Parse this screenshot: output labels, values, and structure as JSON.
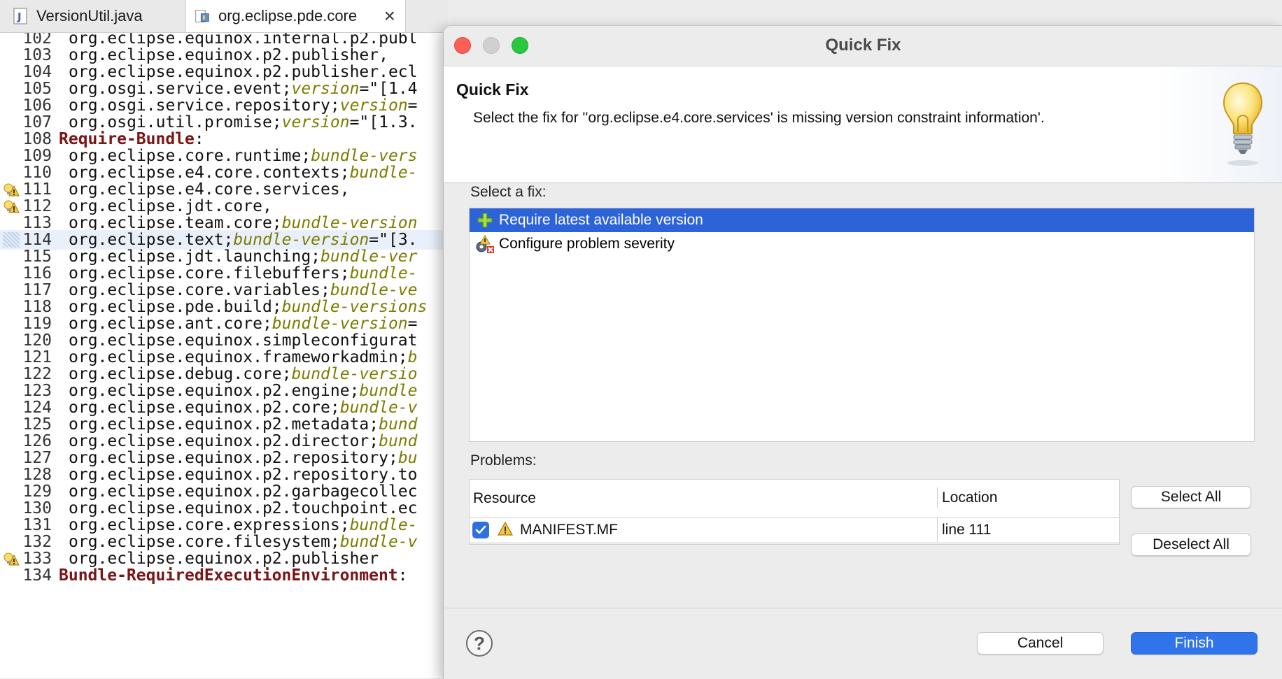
{
  "editor": {
    "tabs": [
      {
        "label": "VersionUtil.java",
        "icon": "java-file-icon"
      },
      {
        "label": "org.eclipse.pde.core",
        "icon": "plugin-manifest-icon",
        "active": true
      }
    ],
    "lines": [
      {
        "num": "102",
        "parts": [
          {
            "t": "org.eclipse.equinox.internal.p2.publ",
            "c": "plain"
          }
        ]
      },
      {
        "num": "103",
        "parts": [
          {
            "t": "org.eclipse.equinox.p2.publisher,",
            "c": "plain"
          }
        ]
      },
      {
        "num": "104",
        "parts": [
          {
            "t": "org.eclipse.equinox.p2.publisher.ecl",
            "c": "plain"
          }
        ]
      },
      {
        "num": "105",
        "parts": [
          {
            "t": "org.osgi.service.event;",
            "c": "plain"
          },
          {
            "t": "version",
            "c": "attr"
          },
          {
            "t": "=\"[1.4",
            "c": "plain"
          }
        ]
      },
      {
        "num": "106",
        "parts": [
          {
            "t": "org.osgi.service.repository;",
            "c": "plain"
          },
          {
            "t": "version",
            "c": "attr"
          },
          {
            "t": "=",
            "c": "plain"
          }
        ]
      },
      {
        "num": "107",
        "parts": [
          {
            "t": "org.osgi.util.promise;",
            "c": "plain"
          },
          {
            "t": "version",
            "c": "attr"
          },
          {
            "t": "=\"[1.3.",
            "c": "plain"
          }
        ]
      },
      {
        "num": "108",
        "header": true,
        "parts": [
          {
            "t": "Require-Bundle",
            "c": "kw"
          },
          {
            "t": ":",
            "c": "plain"
          }
        ]
      },
      {
        "num": "109",
        "parts": [
          {
            "t": "org.eclipse.core.runtime;",
            "c": "plain"
          },
          {
            "t": "bundle-vers",
            "c": "attr"
          }
        ]
      },
      {
        "num": "110",
        "parts": [
          {
            "t": "org.eclipse.e4.core.contexts;",
            "c": "plain"
          },
          {
            "t": "bundle-",
            "c": "attr"
          }
        ]
      },
      {
        "num": "111",
        "marker": "warning",
        "parts": [
          {
            "t": "org.eclipse.e4.core.services,",
            "c": "plain"
          }
        ]
      },
      {
        "num": "112",
        "marker": "warning",
        "parts": [
          {
            "t": "org.eclipse.jdt.core,",
            "c": "plain"
          }
        ]
      },
      {
        "num": "113",
        "parts": [
          {
            "t": "org.eclipse.team.core;",
            "c": "plain"
          },
          {
            "t": "bundle-version",
            "c": "attr"
          }
        ]
      },
      {
        "num": "114",
        "current": true,
        "parts": [
          {
            "t": "org.eclipse.text;",
            "c": "plain"
          },
          {
            "t": "bundle-version",
            "c": "attr"
          },
          {
            "t": "=\"[3.",
            "c": "plain"
          }
        ]
      },
      {
        "num": "115",
        "parts": [
          {
            "t": "org.eclipse.jdt.launching;",
            "c": "plain"
          },
          {
            "t": "bundle-ver",
            "c": "attr"
          }
        ]
      },
      {
        "num": "116",
        "parts": [
          {
            "t": "org.eclipse.core.filebuffers;",
            "c": "plain"
          },
          {
            "t": "bundle-",
            "c": "attr"
          }
        ]
      },
      {
        "num": "117",
        "parts": [
          {
            "t": "org.eclipse.core.variables;",
            "c": "plain"
          },
          {
            "t": "bundle-ve",
            "c": "attr"
          }
        ]
      },
      {
        "num": "118",
        "parts": [
          {
            "t": "org.eclipse.pde.build;",
            "c": "plain"
          },
          {
            "t": "bundle-versions",
            "c": "attr"
          }
        ]
      },
      {
        "num": "119",
        "parts": [
          {
            "t": "org.eclipse.ant.core;",
            "c": "plain"
          },
          {
            "t": "bundle-version",
            "c": "attr"
          },
          {
            "t": "=",
            "c": "plain"
          }
        ]
      },
      {
        "num": "120",
        "parts": [
          {
            "t": "org.eclipse.equinox.simpleconfigurat",
            "c": "plain"
          }
        ]
      },
      {
        "num": "121",
        "parts": [
          {
            "t": "org.eclipse.equinox.frameworkadmin;",
            "c": "plain"
          },
          {
            "t": "b",
            "c": "attr"
          }
        ]
      },
      {
        "num": "122",
        "parts": [
          {
            "t": "org.eclipse.debug.core;",
            "c": "plain"
          },
          {
            "t": "bundle-versio",
            "c": "attr"
          }
        ]
      },
      {
        "num": "123",
        "parts": [
          {
            "t": "org.eclipse.equinox.p2.engine;",
            "c": "plain"
          },
          {
            "t": "bundle",
            "c": "attr"
          }
        ]
      },
      {
        "num": "124",
        "parts": [
          {
            "t": "org.eclipse.equinox.p2.core;",
            "c": "plain"
          },
          {
            "t": "bundle-v",
            "c": "attr"
          }
        ]
      },
      {
        "num": "125",
        "parts": [
          {
            "t": "org.eclipse.equinox.p2.metadata;",
            "c": "plain"
          },
          {
            "t": "bund",
            "c": "attr"
          }
        ]
      },
      {
        "num": "126",
        "parts": [
          {
            "t": "org.eclipse.equinox.p2.director;",
            "c": "plain"
          },
          {
            "t": "bund",
            "c": "attr"
          }
        ]
      },
      {
        "num": "127",
        "parts": [
          {
            "t": "org.eclipse.equinox.p2.repository;",
            "c": "plain"
          },
          {
            "t": "bu",
            "c": "attr"
          }
        ]
      },
      {
        "num": "128",
        "parts": [
          {
            "t": "org.eclipse.equinox.p2.repository.to",
            "c": "plain"
          }
        ]
      },
      {
        "num": "129",
        "parts": [
          {
            "t": "org.eclipse.equinox.p2.garbagecollec",
            "c": "plain"
          }
        ]
      },
      {
        "num": "130",
        "parts": [
          {
            "t": "org.eclipse.equinox.p2.touchpoint.ec",
            "c": "plain"
          }
        ]
      },
      {
        "num": "131",
        "parts": [
          {
            "t": "org.eclipse.core.expressions;",
            "c": "plain"
          },
          {
            "t": "bundle-",
            "c": "attr"
          }
        ]
      },
      {
        "num": "132",
        "parts": [
          {
            "t": "org.eclipse.core.filesystem;",
            "c": "plain"
          },
          {
            "t": "bundle-v",
            "c": "attr"
          }
        ]
      },
      {
        "num": "133",
        "marker": "warning",
        "parts": [
          {
            "t": "org.eclipse.equinox.p2.publisher",
            "c": "plain"
          }
        ]
      },
      {
        "num": "134",
        "header": true,
        "parts": [
          {
            "t": "Bundle-RequiredExecutionEnvironment",
            "c": "kw"
          },
          {
            "t": ":",
            "c": "plain"
          }
        ]
      }
    ]
  },
  "dialog": {
    "window_title": "Quick Fix",
    "banner_title": "Quick Fix",
    "banner_description": "Select the fix for ''org.eclipse.e4.core.services' is missing version constraint information'.",
    "select_fix_label": "Select a fix:",
    "fixes": [
      {
        "label": "Require latest available version",
        "icon": "add-plus-icon",
        "selected": true
      },
      {
        "label": "Configure problem severity",
        "icon": "configure-severity-icon",
        "selected": false
      }
    ],
    "problems_label": "Problems:",
    "columns": {
      "resource": "Resource",
      "location": "Location"
    },
    "problem_rows": [
      {
        "checked": true,
        "icon": "warning-icon",
        "resource": "MANIFEST.MF",
        "location": "line 111"
      }
    ],
    "select_all": "Select All",
    "deselect_all": "Deselect All",
    "cancel": "Cancel",
    "finish": "Finish",
    "help_glyph": "?"
  },
  "colors": {
    "keyword": "#7b1414",
    "attribute": "#7c7c00",
    "selection": "#2d63d8",
    "primary_button": "#2f74ea"
  }
}
